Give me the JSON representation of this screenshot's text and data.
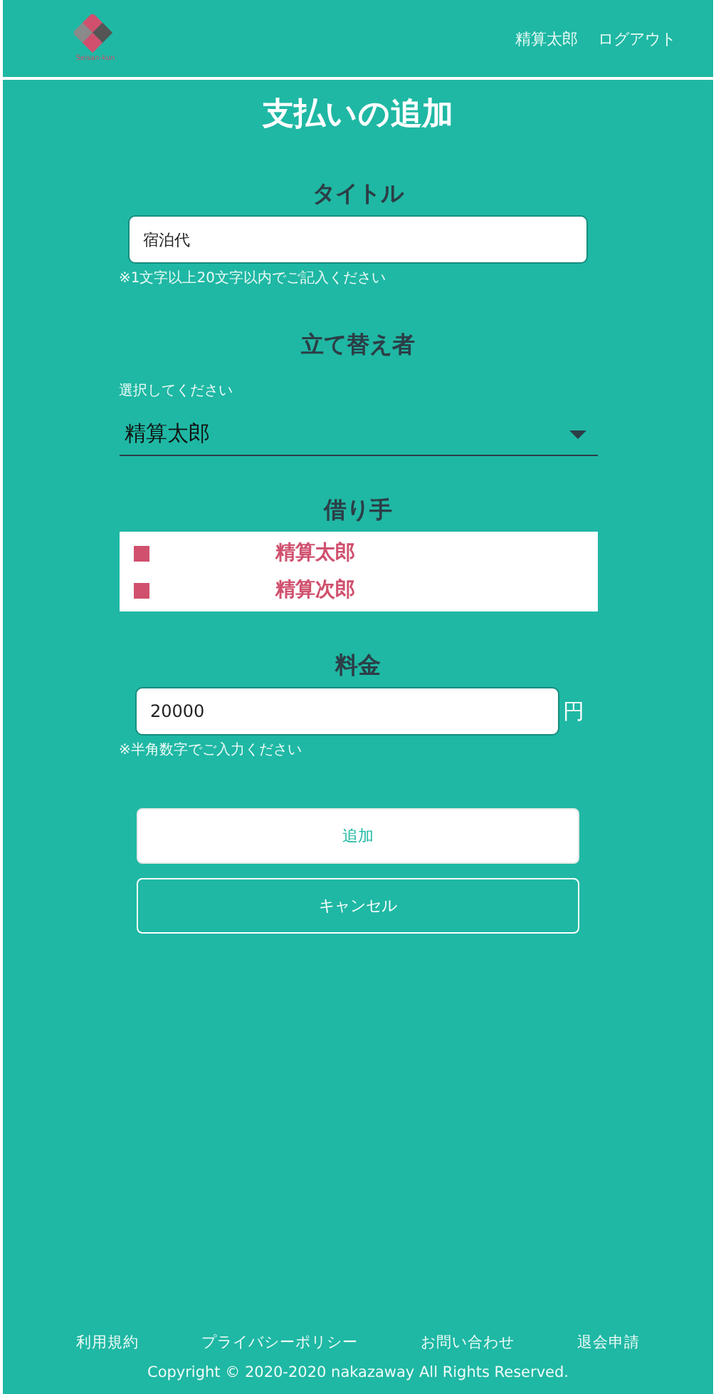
{
  "header": {
    "logo_text": "Seisan-kun",
    "user_name": "精算太郎",
    "logout": "ログアウト"
  },
  "page_title": "支払いの追加",
  "title_field": {
    "label": "タイトル",
    "value": "宿泊代",
    "hint": "※1文字以上20文字以内でご記入ください"
  },
  "payer_field": {
    "label": "立て替え者",
    "caption": "選択してください",
    "value": "精算太郎"
  },
  "borrowers": {
    "label": "借り手",
    "items": [
      {
        "name": "精算太郎",
        "checked": true
      },
      {
        "name": "精算次郎",
        "checked": true
      }
    ]
  },
  "amount_field": {
    "label": "料金",
    "value": "20000",
    "unit": "円",
    "hint": "※半角数字でご入力ください"
  },
  "buttons": [
    {
      "label": "追加",
      "kind": "primary"
    },
    {
      "label": "キャンセル",
      "kind": "outline"
    }
  ],
  "footer": {
    "links": [
      "利用規約",
      "プライバシーポリシー",
      "お問い合わせ",
      "退会申請"
    ],
    "copyright": "Copyright © 2020-2020 nakazaway All Rights Reserved."
  }
}
